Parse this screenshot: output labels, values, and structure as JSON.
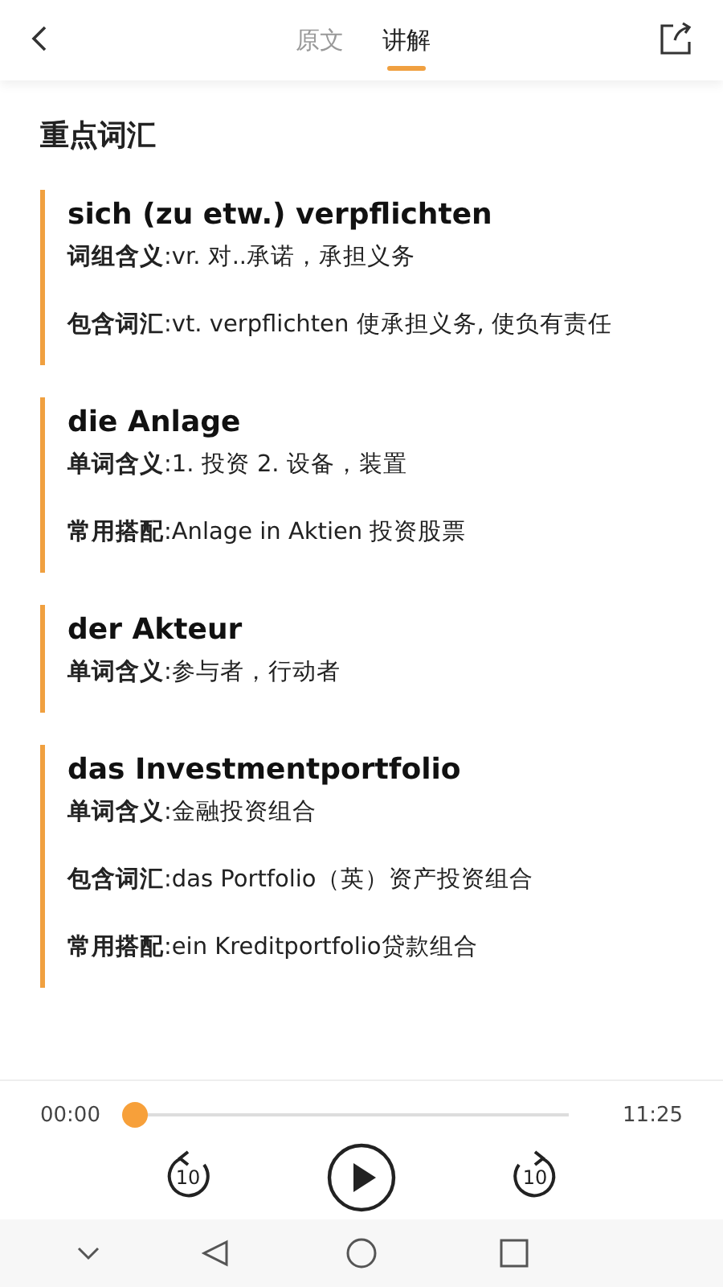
{
  "tabs": [
    {
      "label": "原文",
      "selected": false
    },
    {
      "label": "讲解",
      "selected": true
    }
  ],
  "section_title": "重点词汇",
  "entries": [
    {
      "term": "sich (zu etw.) verpflichten",
      "lines": [
        "**词组含义**:vr. 对..承诺，承担义务",
        "**包含词汇**:vt. verpflichten 使承担义务, 使负有责任"
      ]
    },
    {
      "term": "die Anlage",
      "lines": [
        "**单词含义**:1. 投资 2. 设备，装置",
        "**常用搭配**:Anlage in Aktien 投资股票"
      ]
    },
    {
      "term": "der Akteur",
      "lines": [
        "**单词含义**:参与者，行动者"
      ]
    },
    {
      "term": "das Investmentportfolio",
      "lines": [
        "**单词含义**:金融投资组合",
        "**包含词汇**:das Portfolio（英）资产投资组合",
        "**常用搭配**:ein Kreditportfolio贷款组合"
      ]
    }
  ],
  "player": {
    "current_time": "00:00",
    "total_time": "11:25",
    "level": 0,
    "rewind_label": "10",
    "forward_label": "10"
  }
}
